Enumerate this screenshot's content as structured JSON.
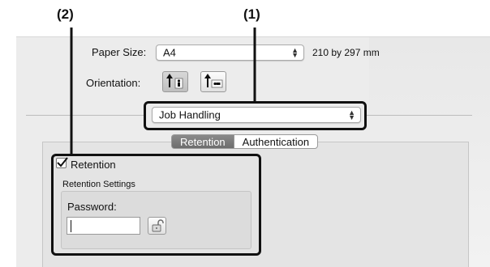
{
  "callouts": {
    "one": "(1)",
    "two": "(2)"
  },
  "paper": {
    "label": "Paper Size:",
    "value": "A4",
    "dimensions": "210 by 297 mm"
  },
  "orientation": {
    "label": "Orientation:",
    "options": [
      "portrait-icon",
      "landscape-icon"
    ],
    "selected": "portrait-icon"
  },
  "panel_select": {
    "value": "Job Handling"
  },
  "tabs": [
    {
      "label": "Retention",
      "active": true
    },
    {
      "label": "Authentication",
      "active": false
    }
  ],
  "retention": {
    "checkbox_label": "Retention",
    "checked": true,
    "settings_label": "Retention Settings",
    "password_label": "Password:",
    "password_value": ""
  },
  "colors": {
    "highlight": "#111111",
    "tab_active": "#7a7a7a"
  }
}
